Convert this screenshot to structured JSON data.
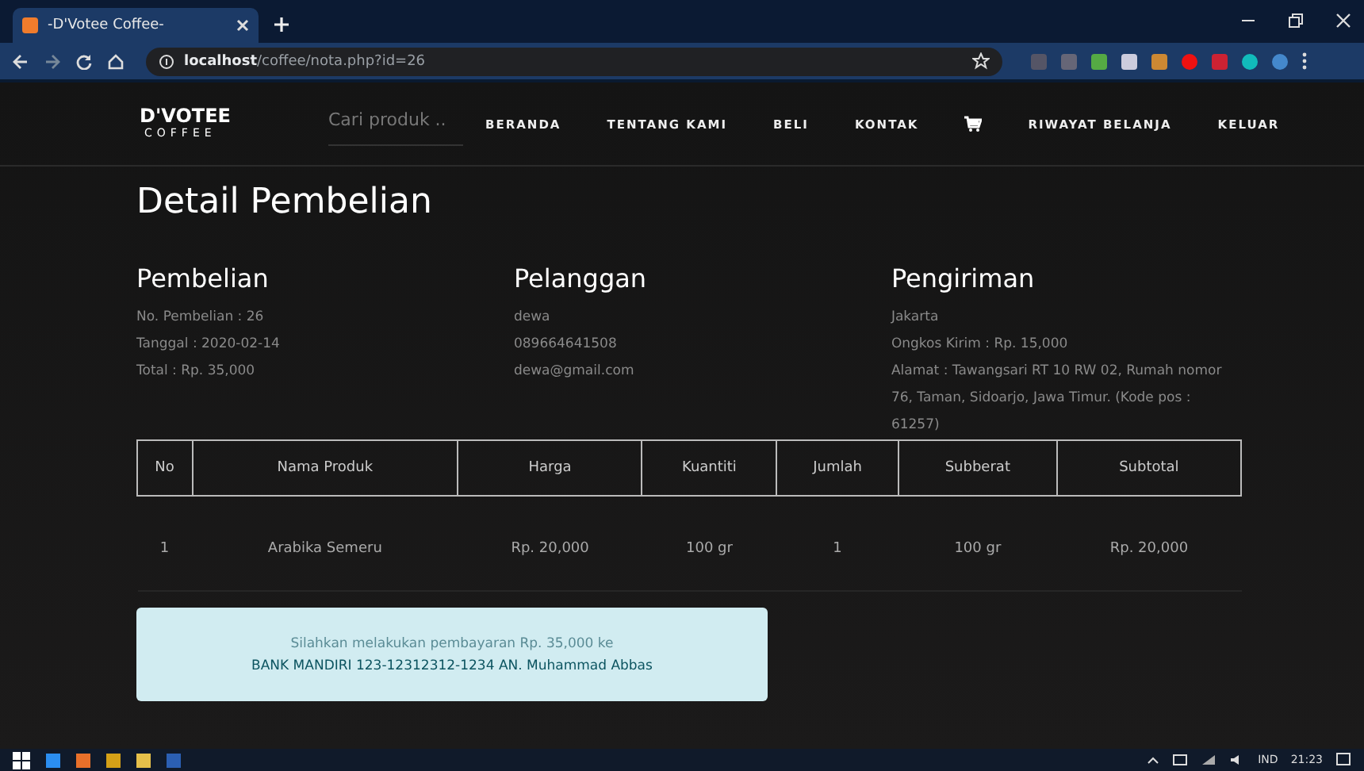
{
  "browser": {
    "tab_title": "-D'Votee Coffee-",
    "url": "**localhost**/coffee/nota.php?id=26"
  },
  "navbar": {
    "logo_main": "D'VOTEE",
    "logo_sub": "COFFEE",
    "search": {
      "placeholder": "Cari produk .."
    },
    "items": [
      {
        "kind": "text",
        "label": "BERANDA"
      },
      {
        "kind": "text",
        "label": "TENTANG KAMI"
      },
      {
        "kind": "text",
        "label": "BELI"
      },
      {
        "kind": "text",
        "label": "KONTAK"
      },
      {
        "kind": "cart"
      },
      {
        "kind": "text",
        "label": "RIWAYAT BELANJA"
      },
      {
        "kind": "text",
        "label": "KELUAR"
      }
    ]
  },
  "title": "Detail Pembelian",
  "sections": [
    {
      "heading": "Pembelian",
      "lines": [
        "No. Pembelian : 26",
        "Tanggal : 2020-02-14",
        "Total : Rp. 35,000"
      ]
    },
    {
      "heading": "Pelanggan",
      "lines": [
        "dewa",
        "089664641508",
        "dewa@gmail.com"
      ]
    },
    {
      "heading": "Pengiriman",
      "lines": [
        "Jakarta",
        "Ongkos Kirim : Rp. 15,000",
        "Alamat : Tawangsari RT 10 RW 02, Rumah nomor 76, Taman, Sidoarjo, Jawa Timur. (Kode pos : 61257)"
      ]
    }
  ],
  "table": {
    "columns": [
      "No",
      "Nama Produk",
      "Harga",
      "Kuantiti",
      "Jumlah",
      "Subberat",
      "Subtotal"
    ],
    "rows": [
      [
        "1",
        "Arabika Semeru",
        "Rp. 20,000",
        "100 gr",
        "1",
        "100 gr",
        "Rp. 20,000"
      ]
    ]
  },
  "alert": [
    "Silahkan melakukan pembayaran Rp. 35,000 ke",
    "BANK MANDIRI 123-12312312-1234 AN. Muhammad Abbas"
  ],
  "taskbar": {
    "language": "IND",
    "time": "21:23"
  }
}
